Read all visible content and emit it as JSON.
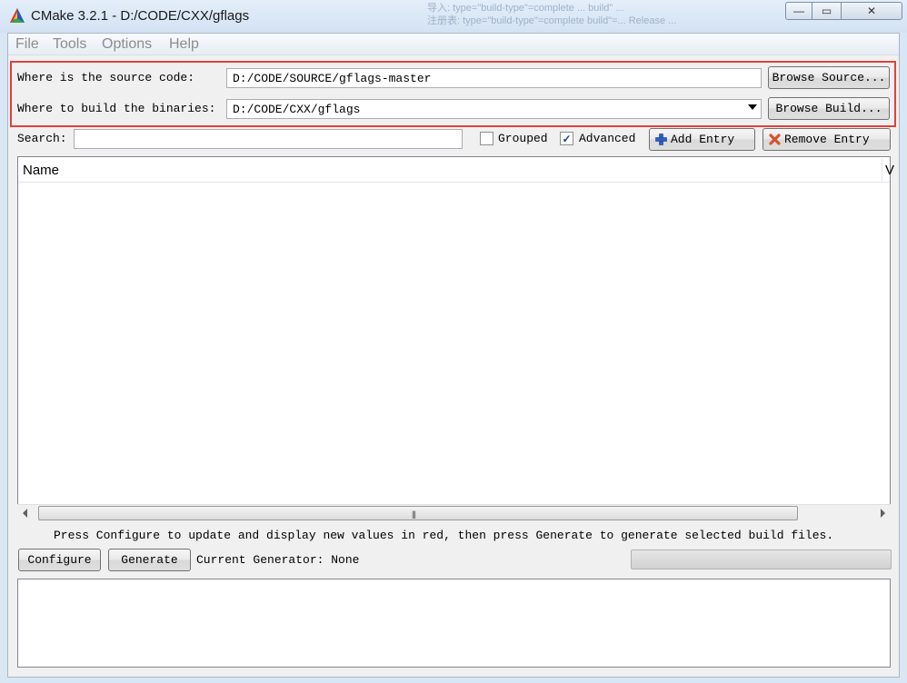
{
  "window": {
    "title": "CMake 3.2.1 - D:/CODE/CXX/gflags",
    "background_text": [
      "导入: type=\"build-type\"=complete ... build\" ... ",
      "注册表: type=\"build-type\"=complete build\"=... Release ... "
    ],
    "controls": {
      "minimize": "—",
      "maximize": "▭",
      "close": "✕"
    }
  },
  "menu": {
    "file": "File",
    "tools": "Tools",
    "options": "Options",
    "help": "Help"
  },
  "paths": {
    "source_label": "Where is the source code:",
    "source_value": "D:/CODE/SOURCE/gflags-master",
    "browse_source": "Browse Source...",
    "build_label": "Where to build the binaries:",
    "build_value": "D:/CODE/CXX/gflags",
    "browse_build": "Browse Build..."
  },
  "toolbar": {
    "search_label": "Search:",
    "search_value": "",
    "grouped_label": "Grouped",
    "grouped_checked": false,
    "advanced_label": "Advanced",
    "advanced_checked": true,
    "add_entry": "Add Entry",
    "remove_entry": "Remove Entry"
  },
  "table": {
    "columns": [
      "Name",
      "V"
    ],
    "rows": []
  },
  "status": {
    "message": "Press Configure to update and display new values in red, then press Generate to generate selected build files."
  },
  "actions": {
    "configure": "Configure",
    "generate": "Generate",
    "current_generator": "Current Generator: None",
    "progress": 0
  },
  "colors": {
    "highlight_border": "#e0413a",
    "add_icon": "#2e5fc4",
    "remove_icon": "#d9532c"
  }
}
